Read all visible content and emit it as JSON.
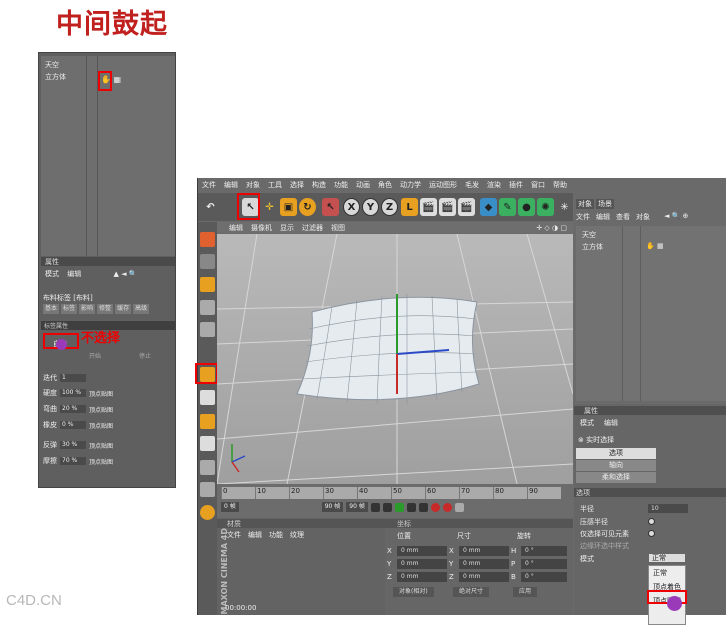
{
  "heading": "中间鼓起",
  "watermark": "C4D.CN",
  "left_panel": {
    "objects": [
      "天空",
      "立方体"
    ],
    "attr_title": "属性",
    "mode_bar": [
      "模式",
      "编辑"
    ],
    "cloth_tag": "布料标签 [布料]",
    "tabs": [
      "基本",
      "标签",
      "影响",
      "修整",
      "缓存",
      "高级"
    ],
    "tag_props": "标签属性",
    "annotation": "不选择",
    "auto_label": "自动",
    "start_label": "开始",
    "stop_label": "停止",
    "props": [
      {
        "label": "迭代",
        "value": "1"
      },
      {
        "label": "硬度",
        "value": "100 %",
        "map": "顶点贴图"
      },
      {
        "label": "弯曲",
        "value": "20 %",
        "map": "顶点贴图"
      },
      {
        "label": "橡皮",
        "value": "0 %",
        "map": "顶点贴图"
      },
      {
        "label": "反弹",
        "value": "30 %",
        "map": "顶点贴图"
      },
      {
        "label": "摩擦",
        "value": "70 %",
        "map": "顶点贴图"
      }
    ]
  },
  "main": {
    "menu": [
      "文件",
      "编辑",
      "对象",
      "工具",
      "选择",
      "构造",
      "功能",
      "动画",
      "角色",
      "动力学",
      "运动图形",
      "毛发",
      "渲染",
      "插件",
      "窗口",
      "帮助"
    ],
    "toolbar": {
      "x": "X",
      "y": "Y",
      "z": "Z"
    },
    "viewport_menu": [
      "编辑",
      "摄像机",
      "显示",
      "过滤器",
      "视图"
    ],
    "viewport_label": "",
    "timeline": {
      "ticks": [
        "0",
        "10",
        "20",
        "30",
        "40",
        "50",
        "60",
        "70",
        "80",
        "90"
      ],
      "start": "0 帧",
      "end": "0 帧",
      "current": "90 帧",
      "end2": "90 帧"
    },
    "material": {
      "title": "材质",
      "menu": [
        "文件",
        "编辑",
        "功能",
        "纹理"
      ],
      "timecode": "00:00:00",
      "brand": "MAXON CINEMA 4D"
    },
    "coordinates": {
      "title": "坐标",
      "headers": [
        "位置",
        "尺寸",
        "旋转"
      ],
      "rows": [
        {
          "axis": "X",
          "pos": "0 mm",
          "sizeAxis": "X",
          "size": "0 mm",
          "rotAxis": "H",
          "rot": "0 °"
        },
        {
          "axis": "Y",
          "pos": "0 mm",
          "sizeAxis": "Y",
          "size": "0 mm",
          "rotAxis": "P",
          "rot": "0 °"
        },
        {
          "axis": "Z",
          "pos": "0 mm",
          "sizeAxis": "Z",
          "size": "0 mm",
          "rotAxis": "B",
          "rot": "0 °"
        }
      ],
      "object_mode": "对象(相对)",
      "absolute": "绝对尺寸",
      "apply": "应用"
    },
    "object_manager": {
      "tabs": [
        "对象",
        "场景"
      ],
      "menu": [
        "文件",
        "编辑",
        "查看",
        "对象"
      ],
      "items": [
        "天空",
        "立方体"
      ]
    },
    "attributes": {
      "title": "属性",
      "menu": [
        "模式",
        "编辑"
      ],
      "tool": "实时选择",
      "buttons": [
        "选项",
        "轴向",
        "柔和选择"
      ],
      "section": "选项",
      "options": [
        {
          "label": "半径",
          "value": "10"
        },
        {
          "label": "压感半径"
        },
        {
          "label": "仅选择可见元素"
        },
        {
          "label": "边缘环选中样式"
        },
        {
          "label": "模式"
        }
      ],
      "mode_value": "正常",
      "dropdown": [
        "正常",
        "顶点着色",
        "顶点贴图"
      ]
    }
  }
}
